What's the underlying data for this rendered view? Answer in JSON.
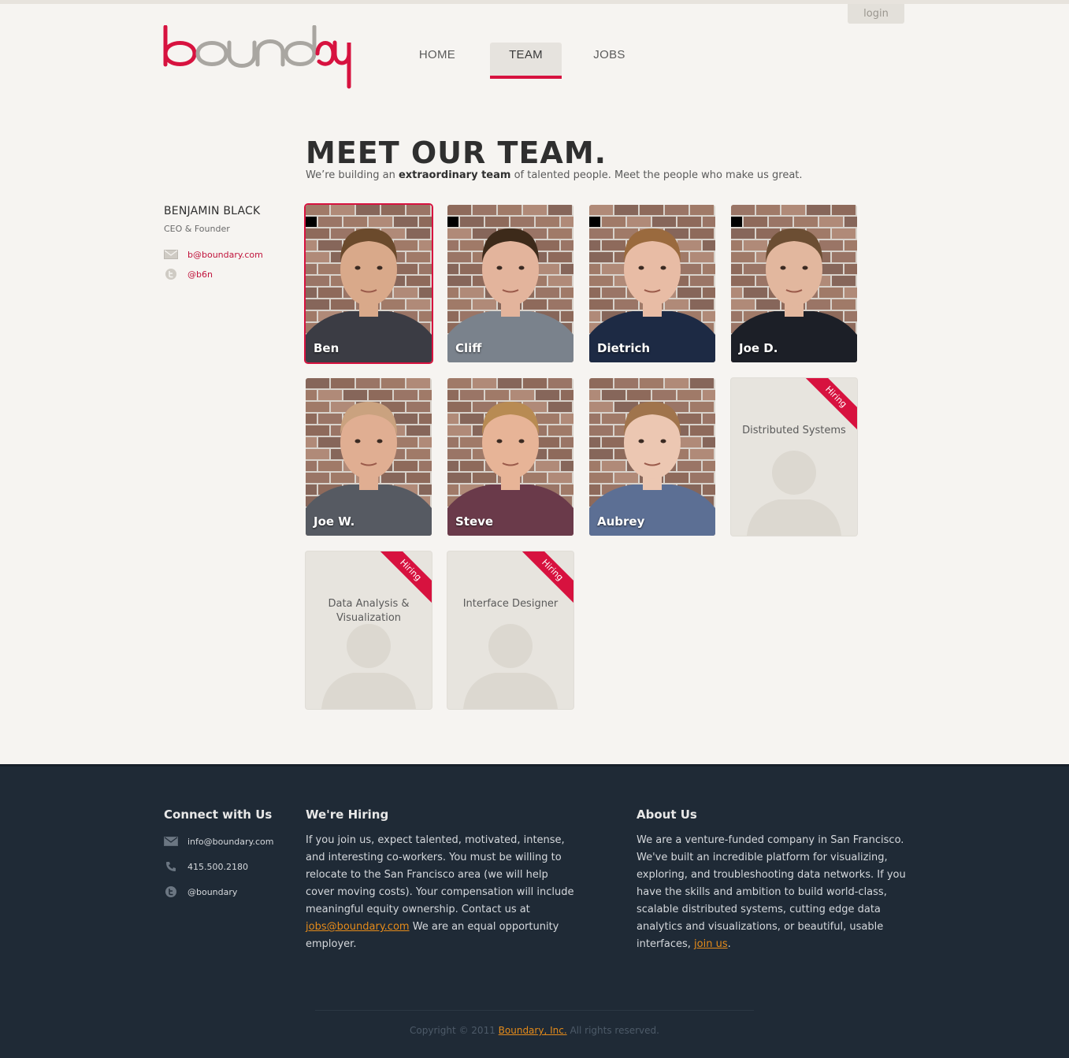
{
  "header": {
    "login_label": "login",
    "brand": "boundary",
    "nav": [
      {
        "label": "HOME"
      },
      {
        "label": "TEAM"
      },
      {
        "label": "JOBS"
      }
    ]
  },
  "main": {
    "title": "MEET OUR TEAM.",
    "subtitle_pre": "We’re building an ",
    "subtitle_bold": "extraordinary team",
    "subtitle_post": " of talented people. Meet the people who make us great."
  },
  "profile": {
    "name": "BENJAMIN BLACK",
    "role": "CEO & Founder",
    "email": "b@boundary.com",
    "twitter": "@b6n"
  },
  "team": [
    {
      "name": "Ben",
      "skin": "#d9a98a",
      "hair": "#6b4a2c",
      "shirt": "#3b3c44",
      "selected": true
    },
    {
      "name": "Cliff",
      "skin": "#e3b49c",
      "hair": "#3d2a1a",
      "shirt": "#7a828c",
      "selected": false
    },
    {
      "name": "Dietrich",
      "skin": "#e8bca5",
      "hair": "#9a6a3e",
      "shirt": "#1d2a44",
      "selected": false
    },
    {
      "name": "Joe D.",
      "skin": "#e2b79e",
      "hair": "#6c4e33",
      "shirt": "#1c1f27",
      "selected": false
    },
    {
      "name": "Joe W.",
      "skin": "#e0ae92",
      "hair": "#caa27f",
      "shirt": "#565a62",
      "selected": false
    },
    {
      "name": "Steve",
      "skin": "#e7b497",
      "hair": "#b88b53",
      "shirt": "#6a3a4a",
      "selected": false
    },
    {
      "name": "Aubrey",
      "skin": "#ecc7b2",
      "hair": "#a0744c",
      "shirt": "#5c6f94",
      "selected": false
    }
  ],
  "openings": [
    {
      "title": "Distributed Systems",
      "badge": "Hiring"
    },
    {
      "title": "Data Analysis & Visualization",
      "badge": "Hiring"
    },
    {
      "title": "Interface Designer",
      "badge": "Hiring"
    }
  ],
  "footer": {
    "connect_heading": "Connect with Us",
    "connect_email": "info@boundary.com",
    "connect_phone": "415.500.2180",
    "connect_twitter": "@boundary",
    "hiring_heading": "We're Hiring",
    "hiring_text_1": "If you join us, expect talented, motivated, intense, and interesting co-workers. You must be willing to relocate to the San Francisco area (we will help cover moving costs). Your compensation will include meaningful equity ownership. Contact us at ",
    "hiring_link": "jobs@boundary.com",
    "hiring_text_2": " We are an equal opportunity employer.",
    "about_heading": "About Us",
    "about_text": "We are a venture-funded company in San Francisco. We've built an incredible platform for visualizing, exploring, and troubleshooting data networks. If you have the skills and ambition to build world-class, scalable distributed systems, cutting edge data analytics and visualizations, or beautiful, usable interfaces, ",
    "about_link": "join us",
    "about_end": ".",
    "copyright_pre": "Copyright © 2011 ",
    "copyright_link": "Boundary, Inc.",
    "copyright_post": " All rights reserved."
  },
  "colors": {
    "accent": "#d7123f",
    "footer_bg": "#1f2a36",
    "link_orange": "#e58b1a"
  }
}
